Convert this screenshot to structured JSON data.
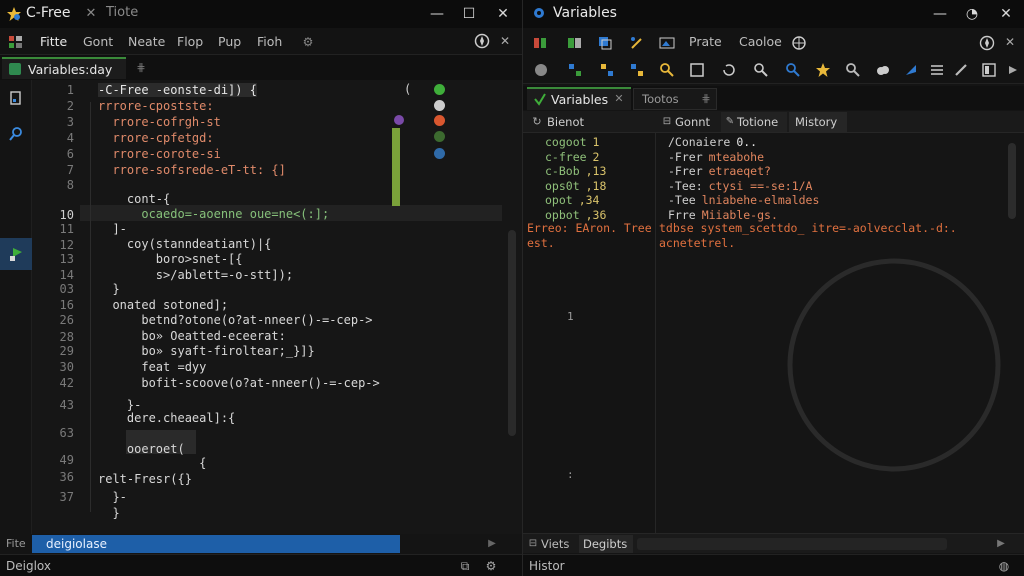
{
  "left": {
    "title": "C-Free",
    "second_title": "Tiote",
    "menu": [
      "Fitte",
      "Gont",
      "Neate",
      "Flop",
      "Pup",
      "Fioh"
    ],
    "tab_label": "Variables:day",
    "status_left": "Fite",
    "status_tab": "deigiolase",
    "bottom_label": "Deiglox",
    "line_numbers": [
      "1",
      "2",
      "3",
      "4",
      "6",
      "7",
      "8",
      "10",
      "11",
      "12",
      "13",
      "14",
      "03",
      "16",
      "26",
      "28",
      "29",
      "30",
      "42",
      "43",
      "63",
      "49",
      "36",
      "37"
    ],
    "code": [
      "-C-Free -eonste-di]) {",
      "rrrore-cpostste:",
      "  rrore-cofrgh-st",
      "  rrore-cpfetgd:",
      "  rrore-corote-si",
      "  rrore-sofsrede-eT-tt: {]",
      "",
      "    cont-{",
      "      ocaedo=-aoenne oue=ne<(:];",
      "  ]-",
      "    coy(stanndeatiant)|{",
      "        boro>snet-[{",
      "        s>/ablett=-o-stt]);",
      "  }",
      "  onated sotoned];",
      "      betnd?otone(o?at-nneer()-=-cep->",
      "      bo» Oeatted-eceerat:",
      "      bo» syaft-firoltear;_}]}",
      "      feat =dyy",
      "      bofit-scoove(o?at-nneer()-=-cep->",
      "    }-",
      "    dere.cheaeal]:{",
      "",
      "    ooeroet(",
      "              {",
      "relt-Fresr({}",
      "  }-",
      "  }"
    ]
  },
  "right": {
    "title": "Variables",
    "toolbar1_label_a": "Prate",
    "toolbar1_label_b": "Caoloe",
    "tab_active": "Variables",
    "tab_other": "Tootos",
    "pane_left_header": "Bienot",
    "pane_right_headers": [
      "Gonnt",
      "Totione",
      "Mistory"
    ],
    "vars": [
      {
        "name": "cogoot",
        "value": "1"
      },
      {
        "name": "c-free",
        "value": "2"
      },
      {
        "name": "c-Bob",
        "value": ",13"
      },
      {
        "name": "ops0t",
        "value": ",18"
      },
      {
        "name": "opot",
        "value": ",34"
      },
      {
        "name": "opbot",
        "value": ",36"
      }
    ],
    "history": [
      {
        "prefix": "/Conaiere",
        "value": "0.."
      },
      {
        "prefix": "-Frer",
        "value": "mteabohe"
      },
      {
        "prefix": "-Frer",
        "value": "etraeqet?"
      },
      {
        "prefix": "-Tee:",
        "value": "ctysi ==-se:1/A"
      },
      {
        "prefix": "-Tee",
        "value": "lniabehe-elmaldes"
      },
      {
        "prefix": "Frre",
        "value": "Miiable-gs."
      }
    ],
    "error_line1_left": "Erreo: EAron. Tree",
    "error_line1_right": "tdbse system_scettdo_ itre=-aolvecclat.-d:.",
    "error_line2_left": "est.",
    "error_line2_right": "acnetetrel.",
    "marker_a": "1",
    "marker_b": ":",
    "bottom_tab_a": "Viets",
    "bottom_tab_b": "Degibts",
    "status": "Histor"
  },
  "colors": {
    "accent_blue": "#1e5fa8",
    "green_marker": "#3fae3a",
    "red_marker": "#d9572f",
    "gray_marker": "#cccccc"
  }
}
